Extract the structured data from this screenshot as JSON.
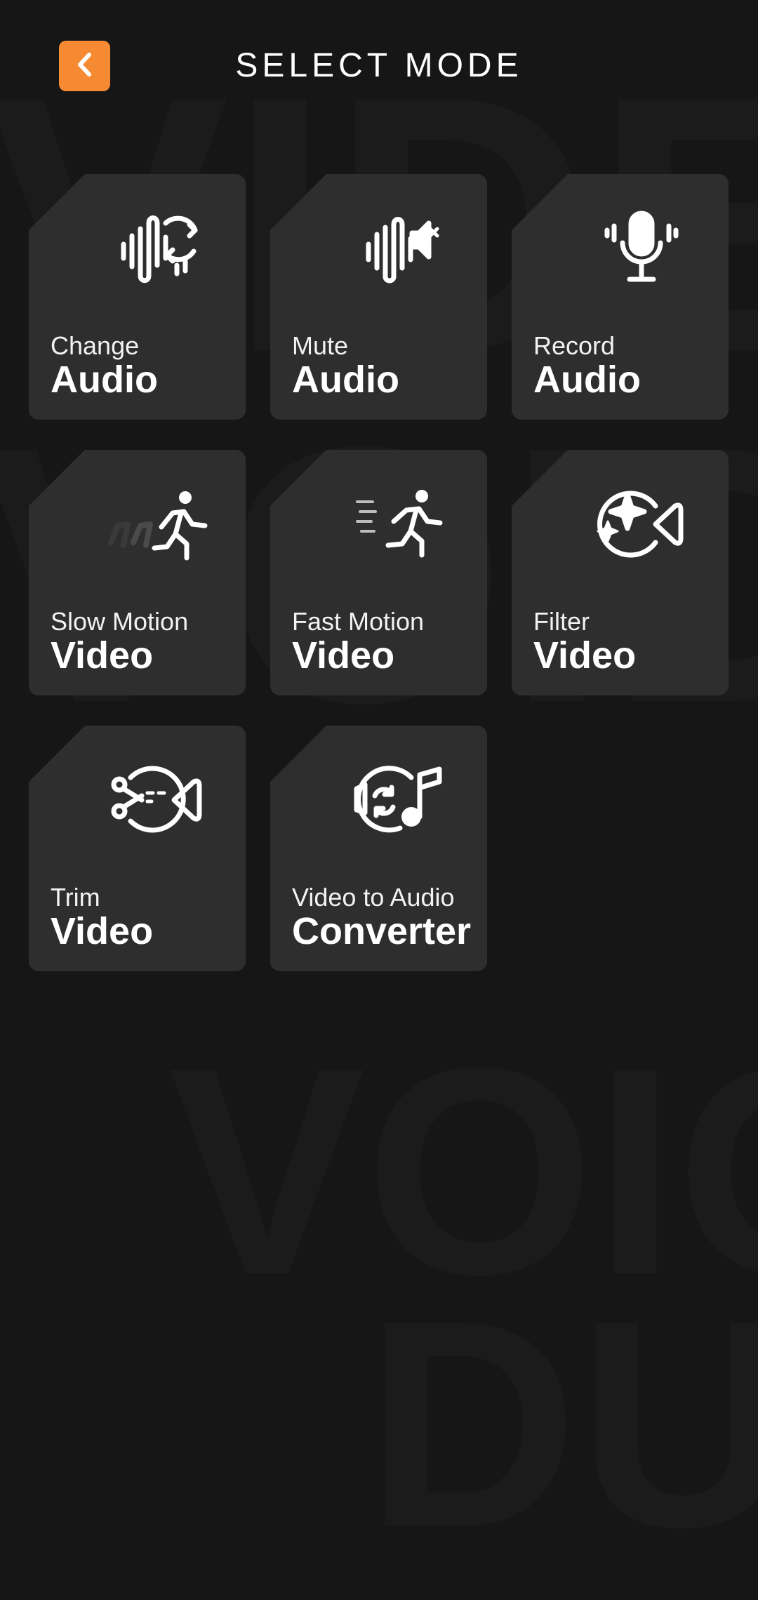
{
  "header": {
    "title": "SELECT MODE",
    "back_icon": "chevron-left-icon",
    "accent_color": "#f58a32"
  },
  "watermark": {
    "line1": "VIDEO",
    "line2": "VOID",
    "line3": "VOIO",
    "line4": "DUI"
  },
  "modes": [
    {
      "subtitle": "Change",
      "title": "Audio",
      "icon": "change-audio-icon"
    },
    {
      "subtitle": "Mute",
      "title": "Audio",
      "icon": "mute-audio-icon"
    },
    {
      "subtitle": "Record",
      "title": "Audio",
      "icon": "microphone-icon"
    },
    {
      "subtitle": "Slow Motion",
      "title": "Video",
      "icon": "slow-motion-runner-icon"
    },
    {
      "subtitle": "Fast Motion",
      "title": "Video",
      "icon": "fast-motion-runner-icon"
    },
    {
      "subtitle": "Filter",
      "title": "Video",
      "icon": "filter-sparkle-camera-icon"
    },
    {
      "subtitle": "Trim",
      "title": "Video",
      "icon": "trim-scissors-camera-icon"
    },
    {
      "subtitle": "Video to Audio",
      "title": "Converter",
      "icon": "video-to-audio-converter-icon"
    }
  ]
}
